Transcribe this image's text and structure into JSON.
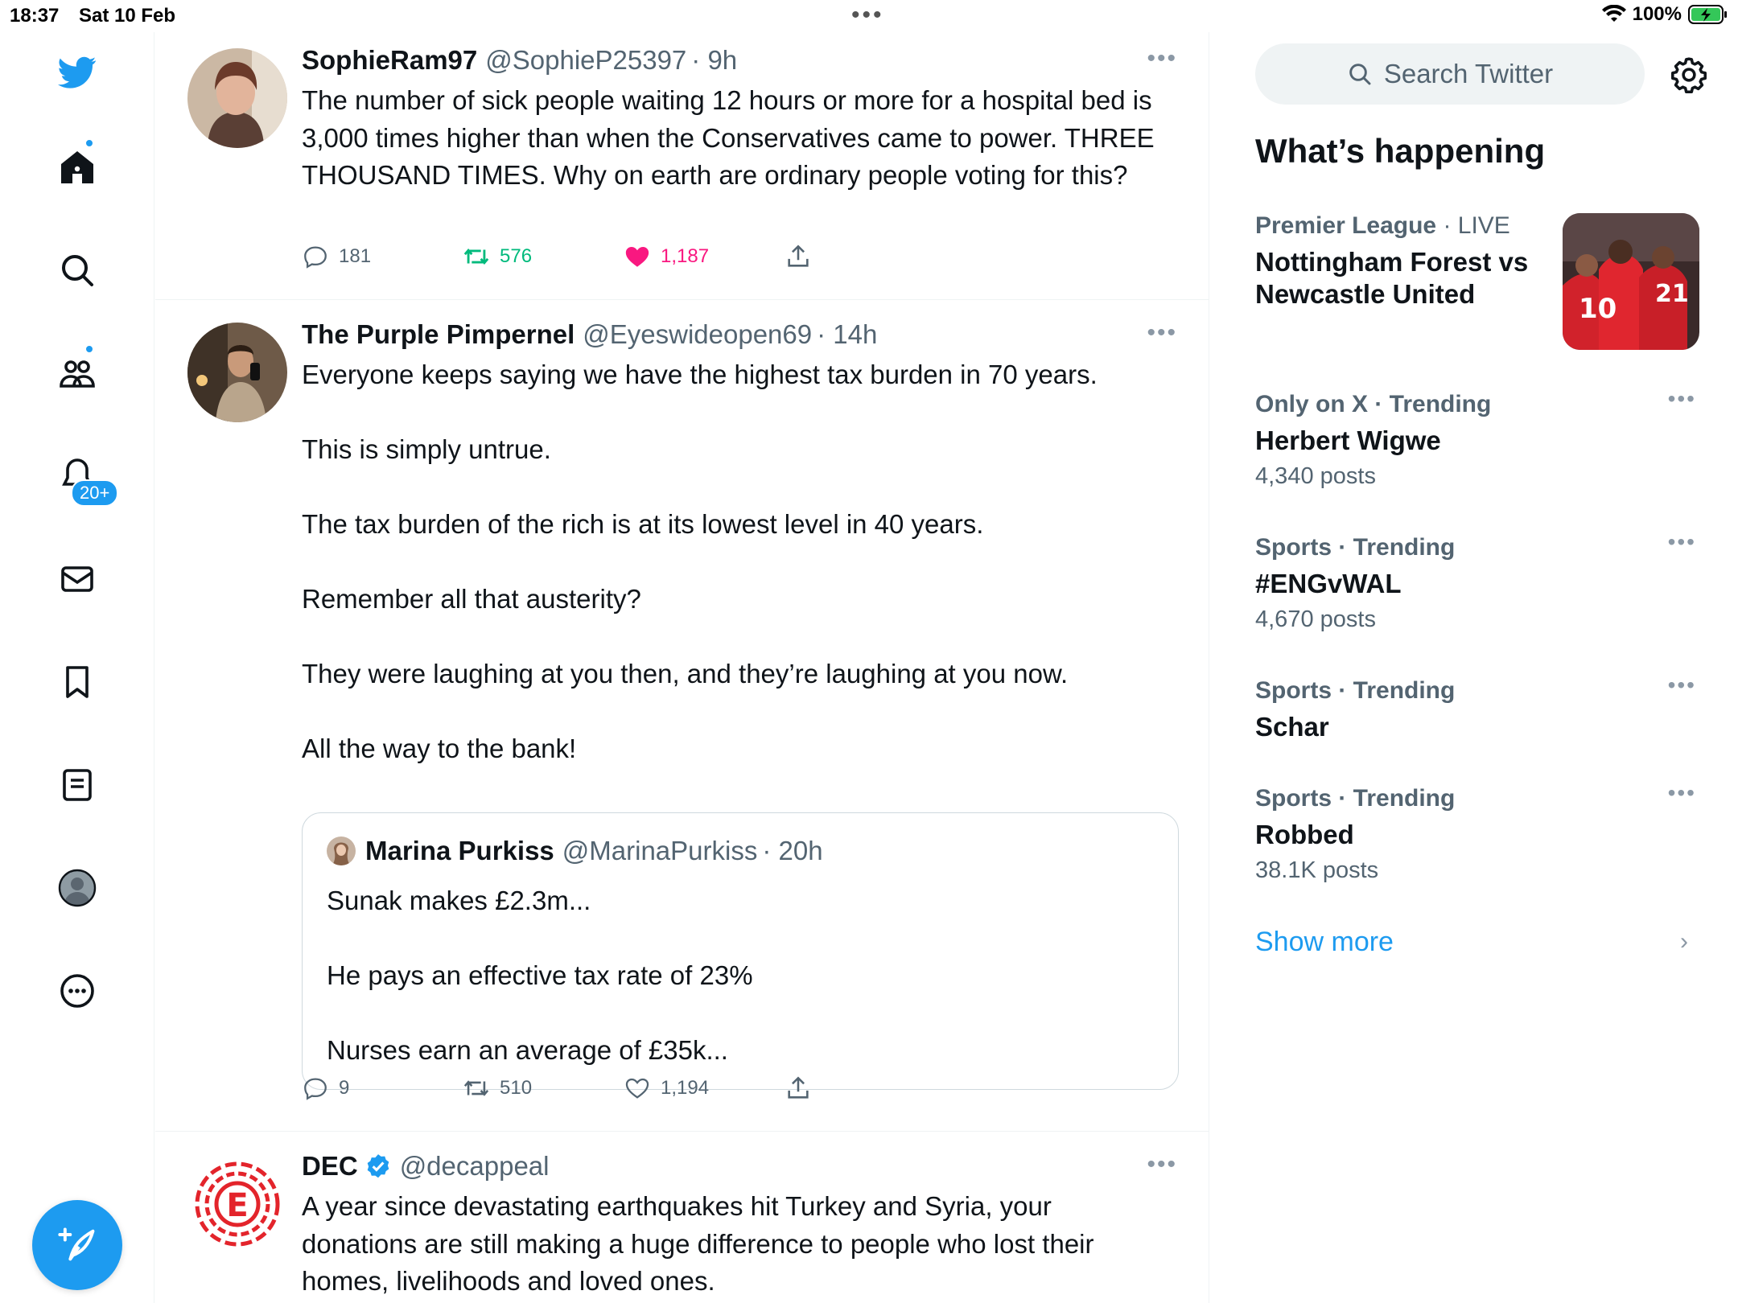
{
  "status": {
    "time": "18:37",
    "date": "Sat 10 Feb",
    "battery_pct": "100%"
  },
  "nav": {
    "notifications_badge": "20+"
  },
  "tweets": [
    {
      "name": "SophieRam97",
      "handle": "@SophieP25397",
      "time": "· 9h",
      "text_lines": [
        "The number of sick people waiting 12 hours or more for a hospital bed is 3,000 times higher than when the Conservatives came to power. THREE THOUSAND TIMES. Why on earth are ordinary people voting for this?"
      ],
      "replies": "181",
      "retweets": "576",
      "likes": "1,187"
    },
    {
      "name": "The Purple Pimpernel",
      "handle": "@Eyeswideopen69",
      "time": "· 14h",
      "paragraphs": [
        "Everyone keeps saying we have the highest tax burden in 70 years.",
        "This is simply untrue.",
        "The tax burden of the rich is at its lowest level in 40 years.",
        "Remember all that austerity?",
        "They were laughing at you then, and they’re laughing at you now.",
        "All the way to the bank!"
      ],
      "quote": {
        "name": "Marina Purkiss",
        "handle": "@MarinaPurkiss",
        "time": "· 20h",
        "paragraphs": [
          "Sunak makes £2.3m...",
          "He pays an effective tax rate of 23%",
          "Nurses earn an average of £35k..."
        ]
      },
      "replies": "9",
      "retweets": "510",
      "likes": "1,194"
    },
    {
      "name": "DEC",
      "handle": "@decappeal",
      "text": "A year since devastating earthquakes hit Turkey and Syria, your donations are still making a huge difference to people who lost their homes, livelihoods and loved ones."
    }
  ],
  "right": {
    "search_placeholder": "Search Twitter",
    "whats_happening": "What’s happening",
    "trends": [
      {
        "category": "Premier League",
        "status": " · LIVE",
        "name": "Nottingham Forest vs Newcastle United",
        "count": ""
      },
      {
        "category": "Only on X · Trending",
        "status": "",
        "name": "Herbert Wigwe",
        "count": "4,340 posts"
      },
      {
        "category": "Sports · Trending",
        "status": "",
        "name": "#ENGvWAL",
        "count": "4,670 posts"
      },
      {
        "category": "Sports · Trending",
        "status": "",
        "name": "Schar",
        "count": ""
      },
      {
        "category": "Sports · Trending",
        "status": "",
        "name": "Robbed",
        "count": "38.1K posts"
      }
    ],
    "show_more": "Show more"
  },
  "colors": {
    "accent": "#1d9bf0",
    "retweet_green": "#00ba7c",
    "like_pink": "#f91880",
    "secondary_text": "#536471"
  }
}
